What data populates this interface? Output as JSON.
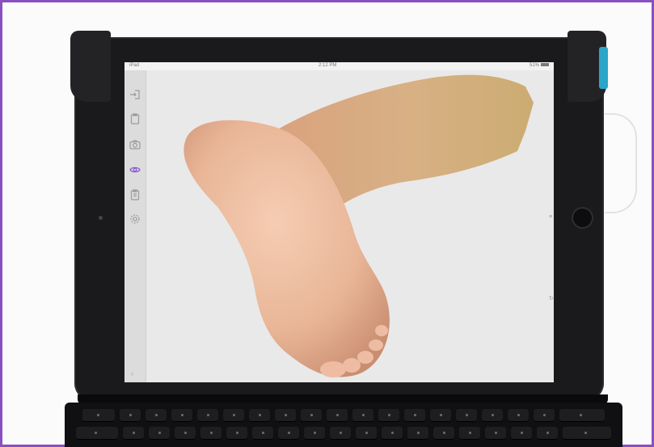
{
  "device": {
    "status_bar": {
      "carrier": "iPad",
      "time": "2:12 PM",
      "battery": "51%"
    },
    "accent_color": "#8a5cd6",
    "frame_color": "#8a4fc0"
  },
  "app": {
    "toolbar": {
      "items": [
        {
          "icon": "import-icon",
          "active": false
        },
        {
          "icon": "clipboard-icon",
          "active": false
        },
        {
          "icon": "camera-icon",
          "active": false
        },
        {
          "icon": "eye-icon",
          "active": true
        },
        {
          "icon": "clipboard-check-icon",
          "active": false
        },
        {
          "icon": "gear-icon",
          "active": false
        }
      ],
      "expand": "›"
    },
    "viewport": {
      "content": "3d-foot-scan"
    }
  }
}
